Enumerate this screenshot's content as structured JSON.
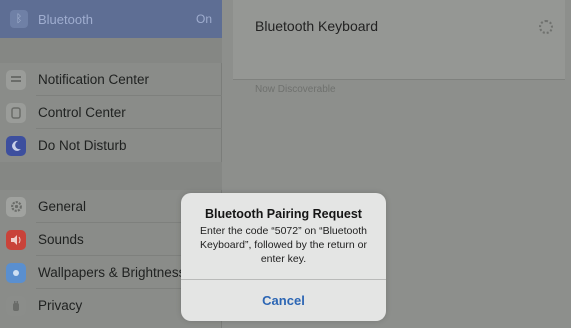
{
  "sidebar": {
    "bluetooth": {
      "label": "Bluetooth",
      "value": "On",
      "icon": "bluetooth-icon"
    },
    "group1": [
      {
        "label": "Notification Center",
        "icon": "notification-center-icon",
        "color": "#9a9c99"
      },
      {
        "label": "Control Center",
        "icon": "control-center-icon",
        "color": "#9a9c99"
      },
      {
        "label": "Do Not Disturb",
        "icon": "moon-icon",
        "color": "#3d4f9e"
      }
    ],
    "group2": [
      {
        "label": "General",
        "icon": "gear-icon",
        "color": "#a0a29f"
      },
      {
        "label": "Sounds",
        "icon": "speaker-icon",
        "color": "#c9433a"
      },
      {
        "label": "Wallpapers & Brightness",
        "icon": "wallpaper-icon",
        "color": "#5a8fcf"
      },
      {
        "label": "Privacy",
        "icon": "hand-icon",
        "color": "#8b8d8a"
      }
    ]
  },
  "detail": {
    "device_name": "Bluetooth Keyboard",
    "discoverable_text": "Now Discoverable"
  },
  "dialog": {
    "title": "Bluetooth Pairing Request",
    "message": "Enter the code “5072” on “Bluetooth Keyboard”, followed by the return or enter key.",
    "cancel_label": "Cancel"
  }
}
